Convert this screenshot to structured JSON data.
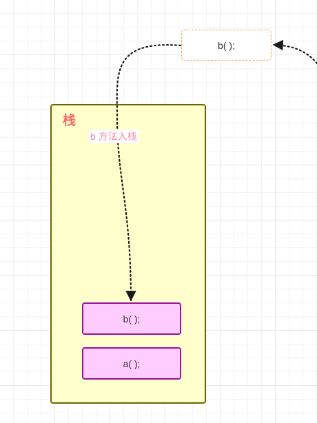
{
  "diagram": {
    "floating_node": {
      "label": "b( );"
    },
    "stack": {
      "title": "栈",
      "frames": [
        {
          "label": "b( );"
        },
        {
          "label": "a( );"
        }
      ]
    },
    "edge_label": "b 方法入栈",
    "colors": {
      "stack_fill": "#ffffcc",
      "stack_border": "#6b6500",
      "frame_fill": "#ffccff",
      "frame_border": "#9a0f9e",
      "title_color": "#f06a6a",
      "edge_label_color": "#f48aa8",
      "floating_border": "#f5a04a",
      "arrow_color": "#1a1a1a"
    }
  }
}
